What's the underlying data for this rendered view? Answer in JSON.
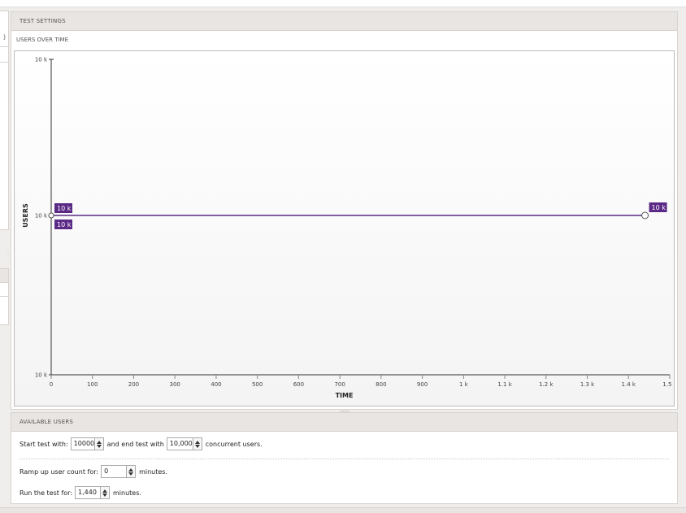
{
  "left_panel": {
    "brace": "}"
  },
  "settings": {
    "title": "TEST SETTINGS",
    "subtitle": "USERS OVER TIME"
  },
  "chart_data": {
    "type": "line",
    "title": "",
    "xlabel": "TIME",
    "ylabel": "USERS",
    "xlim": [
      0,
      1500
    ],
    "x_ticks": [
      0,
      100,
      200,
      300,
      400,
      500,
      600,
      700,
      800,
      900,
      1000,
      1100,
      1200,
      1300,
      1400,
      1500
    ],
    "x_tick_labels": [
      "0",
      "100",
      "200",
      "300",
      "400",
      "500",
      "600",
      "700",
      "800",
      "900",
      "1 k",
      "1.1 k",
      "1.2 k",
      "1.3 k",
      "1.4 k",
      "1.5 k"
    ],
    "y_tick_labels": [
      "10 k",
      "10 k",
      "10 k"
    ],
    "series": [
      {
        "x": [
          0,
          1440
        ],
        "y": [
          10000,
          10000
        ]
      }
    ],
    "point_labels": [
      "10 k",
      "10 k",
      "10 k"
    ],
    "line_color": "#5b2a86",
    "label_bg": "#5b2a86"
  },
  "available": {
    "title": "AVAILABLE USERS",
    "start_label": "Start test with:",
    "start_value": "10000",
    "mid_label": "and end test with",
    "end_value": "10,000",
    "end_suffix": "concurrent users.",
    "ramp_label": "Ramp up user count for:",
    "ramp_value": "0",
    "ramp_suffix": "minutes.",
    "run_label": "Run the test for:",
    "run_value": "1,440",
    "run_suffix": "minutes."
  },
  "splitter": "▫▫▫"
}
